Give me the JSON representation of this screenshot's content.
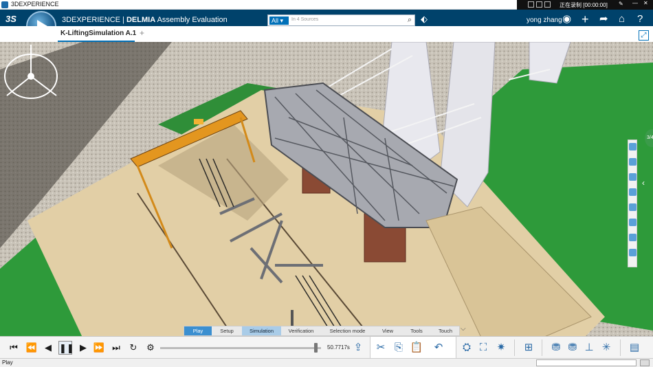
{
  "window": {
    "title": "3DEXPERIENCE",
    "recording_text": "正在录制 [00:00:00]",
    "min_glyph": "—",
    "close_glyph": "✕"
  },
  "header": {
    "brand": "3DEXPERIENCE",
    "separator": " | ",
    "app_brand": "DELMIA",
    "app_name": " Assembly Evaluation",
    "search": {
      "scope": "All",
      "placeholder": "In 4 Sources"
    },
    "user": "yong zhang",
    "icons": [
      "compass-icon",
      "tag-icon",
      "user-icon",
      "add-icon",
      "share-icon",
      "home-icon",
      "help-icon"
    ]
  },
  "tab": {
    "label": "K-LiftingSimulation A.1",
    "add_label": "+"
  },
  "side": {
    "collapsed_label": "3/4",
    "arrow": "‹"
  },
  "command_tabs": {
    "items": [
      {
        "label": "Play",
        "state": "active"
      },
      {
        "label": "Setup",
        "state": "normal"
      },
      {
        "label": "Simulation",
        "state": "highlight"
      },
      {
        "label": "Verification",
        "state": "normal"
      },
      {
        "label": "Selection mode",
        "state": "normal"
      },
      {
        "label": "View",
        "state": "normal"
      },
      {
        "label": "Tools",
        "state": "normal"
      },
      {
        "label": "Touch",
        "state": "normal"
      }
    ],
    "more": "⌵"
  },
  "player": {
    "time": "50.7717s",
    "progress": 0.98,
    "buttons": [
      "skip-to-start",
      "step-back",
      "play-backward",
      "pause",
      "play-forward",
      "step-forward",
      "skip-to-end",
      "loop",
      "settings"
    ]
  },
  "status": {
    "text": "Play"
  },
  "colors": {
    "brand_bar": "#00426b",
    "accent": "#0070b8",
    "active_tab": "#3b8fd0",
    "highlight_tab": "#a9cce8",
    "ground": "#e2cfa6",
    "grass": "#2e9a3a",
    "crane": "#e3961f",
    "truss": "#a7a9b0"
  }
}
